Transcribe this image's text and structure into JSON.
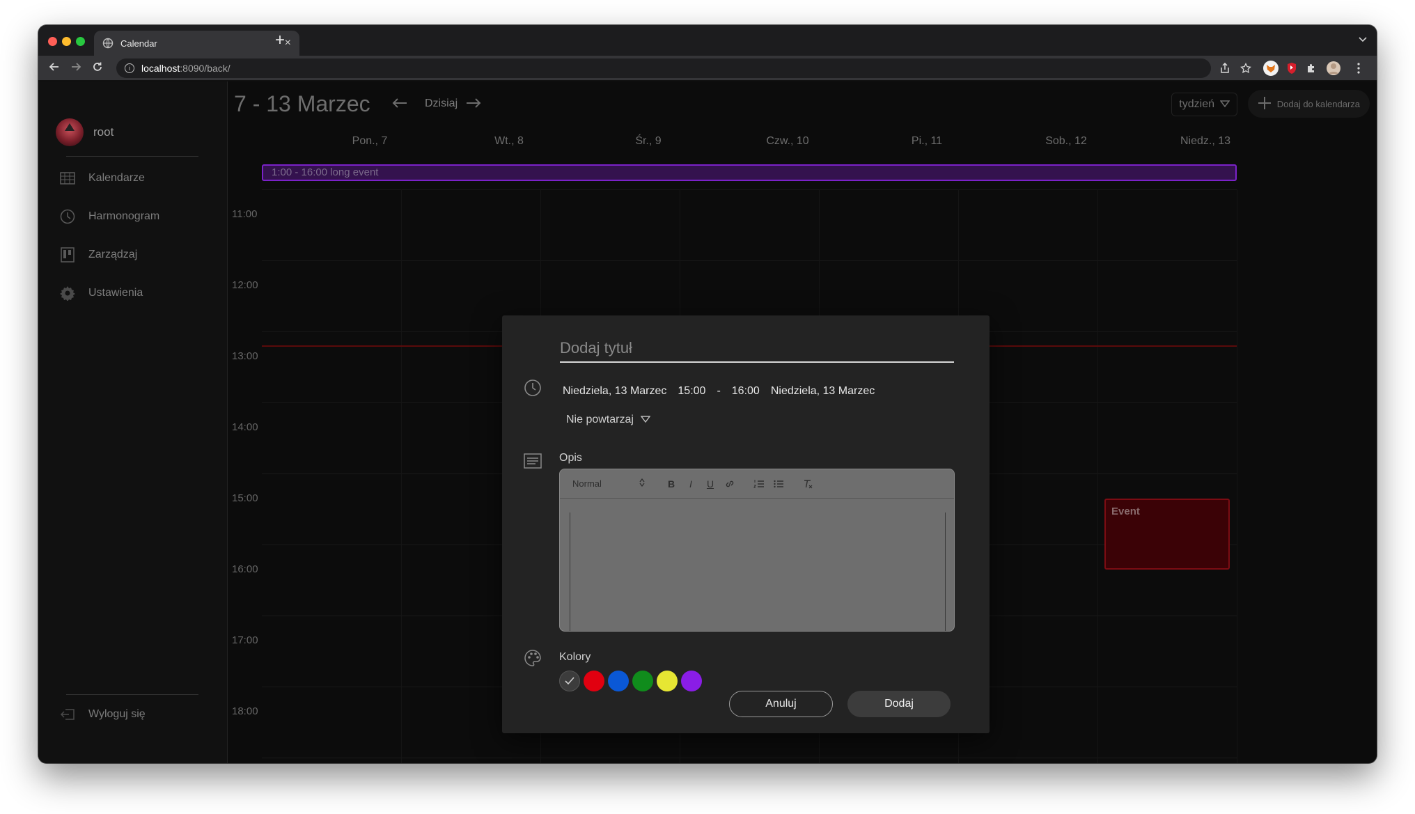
{
  "browser": {
    "tab_title": "Calendar",
    "url_host": "localhost",
    "url_path": ":8090/back/",
    "new_tab_label": "+",
    "tab_close": "×"
  },
  "sidebar": {
    "username": "root",
    "items": [
      {
        "label": "Kalendarze",
        "icon": "calendar-grid-icon"
      },
      {
        "label": "Harmonogram",
        "icon": "clock-icon"
      },
      {
        "label": "Zarządzaj",
        "icon": "kanban-icon"
      },
      {
        "label": "Ustawienia",
        "icon": "gear-icon"
      }
    ],
    "logout_label": "Wyloguj się"
  },
  "header": {
    "date_range": "7 - 13 Marzec",
    "today_label": "Dzisiaj",
    "view_label": "tydzień",
    "add_calendar_label": "Dodaj do kalendarza"
  },
  "days": [
    "Pon., 7",
    "Wt., 8",
    "Śr., 9",
    "Czw., 10",
    "Pi., 11",
    "Sob., 12",
    "Niedz., 13"
  ],
  "allday_event": {
    "label": "1:00 - 16:00 long event",
    "color": "#7b22c9"
  },
  "hours": [
    "11:00",
    "12:00",
    "13:00",
    "14:00",
    "15:00",
    "16:00",
    "17:00",
    "18:00"
  ],
  "event": {
    "label": "Event",
    "color": "#7c0c13"
  },
  "modal": {
    "title_placeholder": "Dodaj tytuł",
    "start_date": "Niedziela, 13 Marzec",
    "start_time": "15:00",
    "separator": "-",
    "end_time": "16:00",
    "end_date": "Niedziela, 13 Marzec",
    "repeat_label": "Nie powtarzaj",
    "description_label": "Opis",
    "format_select": "Normal",
    "colors_label": "Kolory",
    "colors": [
      "#3c3c3c",
      "#e10010",
      "#0a58d6",
      "#108c1c",
      "#e6e633",
      "#8a1de6"
    ],
    "cancel_label": "Anuluj",
    "add_label": "Dodaj"
  }
}
